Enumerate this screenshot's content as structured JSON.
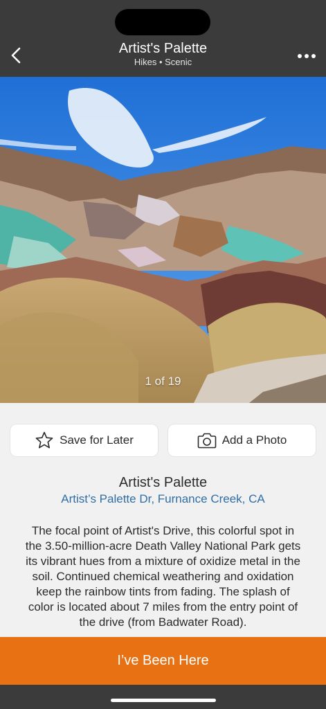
{
  "header": {
    "title": "Artist's Palette",
    "subtitle": "Hikes • Scenic",
    "back_icon": "chevron-left-icon",
    "more_icon": "more-horizontal-icon"
  },
  "gallery": {
    "counter": "1 of 19",
    "current": 1,
    "total": 19
  },
  "actions": {
    "save_label": "Save for Later",
    "save_icon": "star-outline-icon",
    "photo_label": "Add a Photo",
    "photo_icon": "camera-icon"
  },
  "place": {
    "name": "Artist's Palette",
    "address": "Artist’s Palette Dr, Furnance Creek, CA",
    "description": "The focal point of Artist's Drive, this colorful spot in the 3.50-million-acre Death Valley National Park gets its vibrant hues from a mixture of oxidize metal in the soil. Continued chemical weathering and oxidation keep the rainbow tints from fading. The splash of color is located about 7 miles from the entry point of the drive (from Badwater Road)."
  },
  "cta": {
    "label": "I’ve Been Here"
  },
  "colors": {
    "header_bg": "#3b3b3b",
    "accent": "#e87213",
    "link": "#2f6ea5",
    "page_bg": "#f1f1f1"
  }
}
